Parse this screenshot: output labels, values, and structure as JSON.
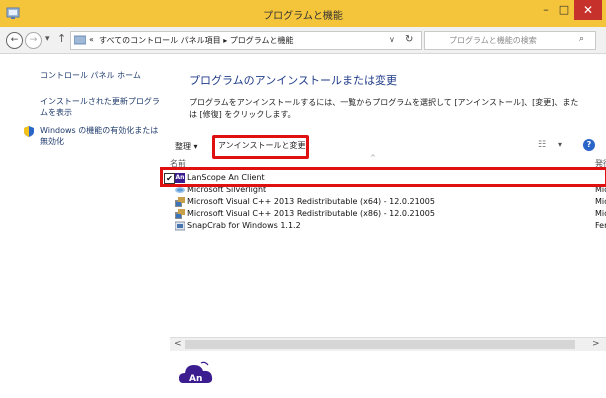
{
  "window": {
    "title": "プログラムと機能",
    "controls": {
      "minimize": "–",
      "maximize": "□",
      "close": "✕"
    },
    "title_bar_color": "#f4c43a",
    "close_color": "#c7312b"
  },
  "address_bar": {
    "back": "←",
    "forward": "→",
    "history": "▾",
    "up": "↑",
    "path_prefix": "«",
    "path": "すべてのコントロール パネル項目 ▸ プログラムと機能",
    "dropdown": "∨",
    "refresh": "↻",
    "search_placeholder": "プログラムと機能の検索",
    "search_icon": "⌕"
  },
  "sidebar": {
    "links": [
      {
        "label": "コントロール パネル ホーム"
      },
      {
        "label": "インストールされた更新プログラムを表示"
      },
      {
        "label": "Windows の機能の有効化または無効化"
      }
    ]
  },
  "main": {
    "heading": "プログラムのアンインストールまたは変更",
    "description": "プログラムをアンインストールするには、一覧からプログラムを選択して [アンインストール]、[変更]、または [修復] をクリックします。"
  },
  "toolbar": {
    "organize": "整理 ▾",
    "uninstall_change": "アンインストールと変更",
    "view_icon": "☷",
    "view_dropdown": "▾",
    "help": "?"
  },
  "columns": {
    "name": "名前",
    "sort_indicator": "^",
    "publisher": "発行"
  },
  "programs": [
    {
      "name": "LanScope An Client",
      "publisher": "",
      "icon": "an-icon",
      "checked": "✔"
    },
    {
      "name": "Microsoft Silverlight",
      "publisher": "Mic",
      "icon": "silverlight-icon"
    },
    {
      "name": "Microsoft Visual C++ 2013 Redistributable (x64) - 12.0.21005",
      "publisher": "Mic",
      "icon": "installer-icon"
    },
    {
      "name": "Microsoft Visual C++ 2013 Redistributable (x86) - 12.0.21005",
      "publisher": "Mic",
      "icon": "installer-icon"
    },
    {
      "name": "SnapCrab for Windows 1.1.2",
      "publisher": "Fen",
      "icon": "snapcrab-icon"
    }
  ],
  "scrollbar": {
    "left": "<",
    "right": ">"
  },
  "detail": {
    "logo_text": "An"
  },
  "colors": {
    "highlight": "#e01010",
    "link": "#1e3a6b",
    "heading": "#1e3a8a",
    "an_brand": "#3b1d8f"
  }
}
